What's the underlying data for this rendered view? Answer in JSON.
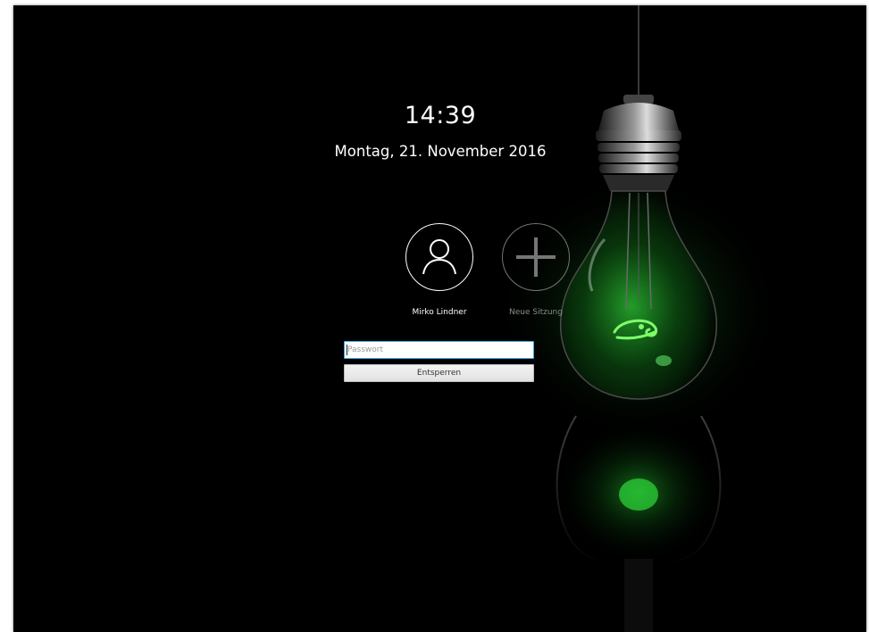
{
  "lockscreen": {
    "time": "14:39",
    "date": "Montag, 21. November 2016"
  },
  "users": [
    {
      "name": "Mirko Lindner",
      "icon": "user-icon"
    },
    {
      "name": "Neue Sitzung",
      "icon": "plus-icon"
    }
  ],
  "login": {
    "password_placeholder": "Passwort",
    "password_value": "",
    "unlock_label": "Entsperren"
  },
  "colors": {
    "background": "#000000",
    "bulb_glow": "#23c32a",
    "focus_border": "#3daee9"
  }
}
